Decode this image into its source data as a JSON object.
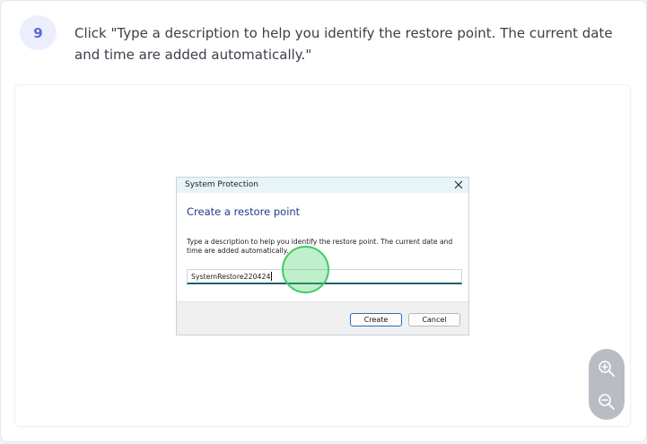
{
  "step": {
    "number": "9",
    "instruction": "Click \"Type a description to help you identify the restore point. The current date and time are added automatically.\""
  },
  "dialog": {
    "title": "System Protection",
    "heading": "Create a restore point",
    "description": "Type a description to help you identify the restore point. The current date and time are added automatically.",
    "input_value": "SystemRestore220424",
    "create_label": "Create",
    "cancel_label": "Cancel"
  },
  "icons": {
    "close": "close-icon",
    "zoom_in": "zoom-in-icon",
    "zoom_out": "zoom-out-icon"
  },
  "colors": {
    "badge_bg": "#eceefd",
    "badge_text": "#5a68d6",
    "click_indicator": "#3ccd62",
    "dialog_heading": "#1f3d8a"
  }
}
